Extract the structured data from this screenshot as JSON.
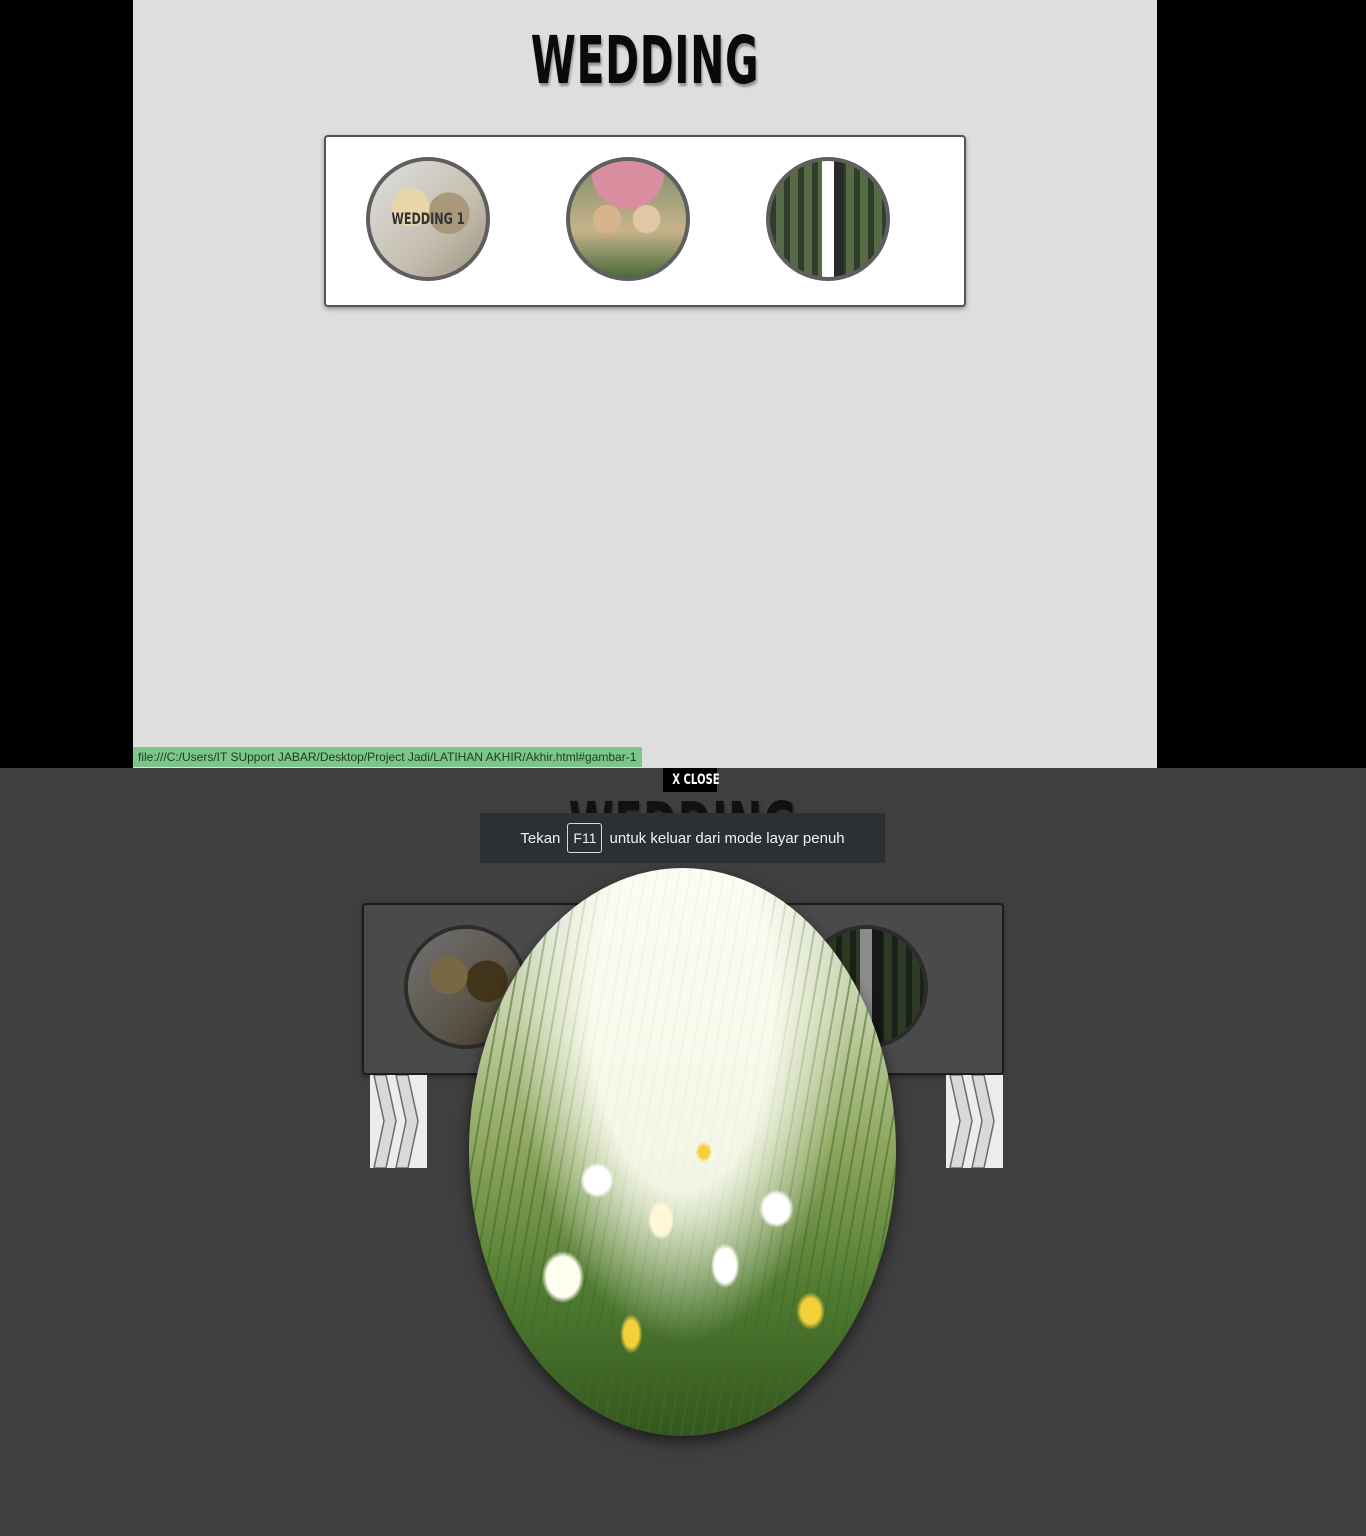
{
  "top_screen": {
    "title": "WEDDING",
    "thumbnails": [
      {
        "label": "WEDDING 1"
      },
      {
        "label": ""
      },
      {
        "label": ""
      }
    ],
    "status_url": "file:///C:/Users/IT SUpport JABAR/Desktop/Project Jadi/LATIHAN AKHIR/Akhir.html#gambar-1"
  },
  "bottom_screen": {
    "title": "WEDDING",
    "close_label": "X CLOSE",
    "fullscreen_notice": {
      "prefix": "Tekan",
      "key": "F11",
      "suffix": "untuk keluar dari mode layar penuh"
    }
  },
  "colors": {
    "page_background": "#dedede",
    "letterbox": "#000000",
    "overlay_background": "#3f3f3f",
    "status_bar": "#7cc68b"
  },
  "icons": {
    "prev_arrow": "double-chevron-icon",
    "next_arrow": "double-chevron-icon"
  }
}
